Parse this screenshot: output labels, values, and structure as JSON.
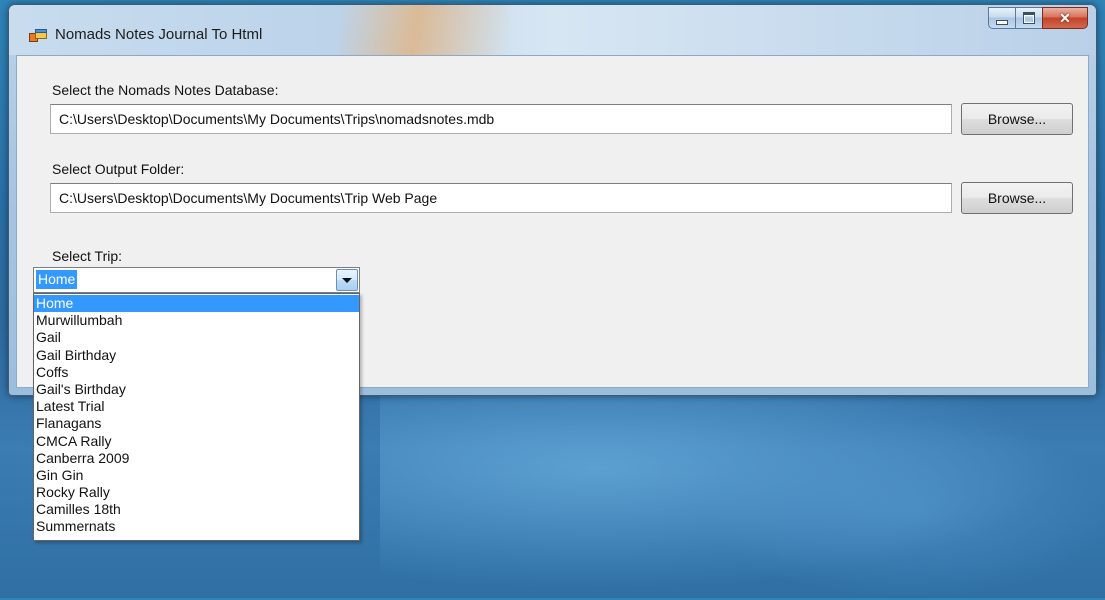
{
  "window": {
    "title": "Nomads Notes Journal To Html",
    "close_glyph": "✕"
  },
  "database": {
    "label": "Select the Nomads Notes Database:",
    "value": "C:\\Users\\Desktop\\Documents\\My Documents\\Trips\\nomadsnotes.mdb",
    "browse_label": "Browse..."
  },
  "output": {
    "label": "Select Output Folder:",
    "value": "C:\\Users\\Desktop\\Documents\\My Documents\\Trip Web Page",
    "browse_label": "Browse..."
  },
  "trip": {
    "label": "Select Trip:",
    "selected": "Home",
    "options": [
      "Home",
      "Murwillumbah",
      "Gail",
      "Gail Birthday",
      "Coffs",
      "Gail's Birthday",
      "Latest Trial",
      "Flanagans",
      "CMCA Rally",
      "Canberra 2009",
      "Gin Gin",
      "Rocky Rally",
      "Camilles 18th",
      "Summernats"
    ]
  },
  "colors": {
    "selection": "#3399ff",
    "close_button": "#c4432a",
    "desktop": "#2f6fa3"
  },
  "icons": {
    "app": "app-window-icon",
    "minimize": "minimize-icon",
    "maximize": "maximize-icon",
    "close": "close-icon",
    "dropdown": "chevron-down-icon"
  }
}
